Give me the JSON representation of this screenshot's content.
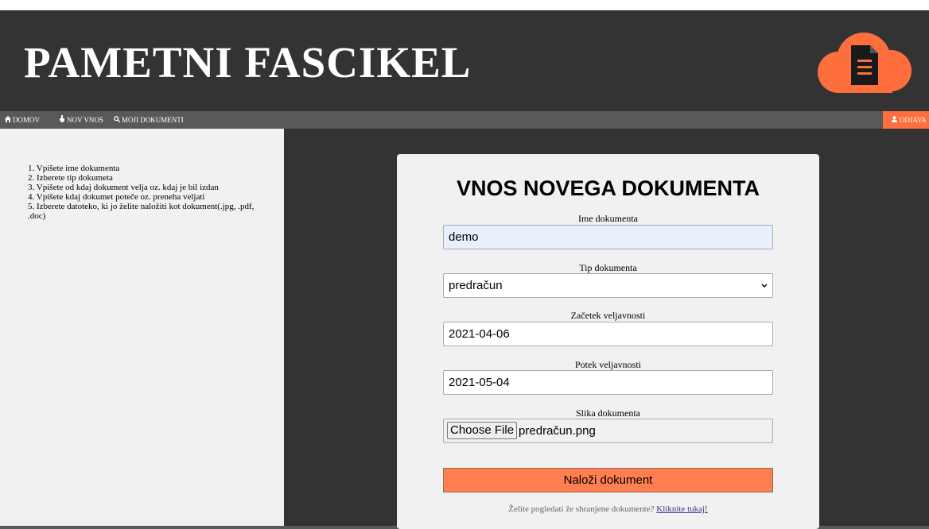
{
  "header": {
    "title": "PAMETNI FASCIKEL",
    "logo_icon": "cloud-document-icon"
  },
  "nav": {
    "home": {
      "label": "DOMOV",
      "icon": "home-icon"
    },
    "new": {
      "label": "NOV VNOS",
      "icon": "hand-icon"
    },
    "docs": {
      "label": "MOJI DOKUMENTI",
      "icon": "search-icon"
    },
    "logout": {
      "label": "ODJAVA",
      "icon": "user-icon"
    }
  },
  "sidebar": {
    "steps": [
      "1. Vpišete ime dokumenta",
      "2. Izberete tip dokumeta",
      "3. Vpišete od kdaj dokument velja oz. kdaj je bil izdan",
      "4. Vpišete kdaj dokumet poteče oz. preneha veljati",
      "5. Izberete datoteko, ki jo želite naložiti kot dokument(.jpg, .pdf, .doc)"
    ]
  },
  "form": {
    "title": "VNOS NOVEGA DOKUMENTA",
    "name_label": "Ime dokumenta",
    "name_value": "demo",
    "type_label": "Tip dokumenta",
    "type_value": "predračun",
    "start_label": "Začetek veljavnosti",
    "start_value": "2021-04-06",
    "end_label": "Potek veljavnosti",
    "end_value": "2021-05-04",
    "file_label": "Slika dokumenta",
    "file_button": "Choose File",
    "file_name": "predračun.png",
    "submit_label": "Naloži dokument",
    "view_text": "Želite pogledati že shranjene dokumente?",
    "view_link": "Kliknite tukaj!"
  },
  "colors": {
    "accent": "#ff7f50",
    "header_bg": "#333333",
    "nav_bg": "#595959"
  }
}
